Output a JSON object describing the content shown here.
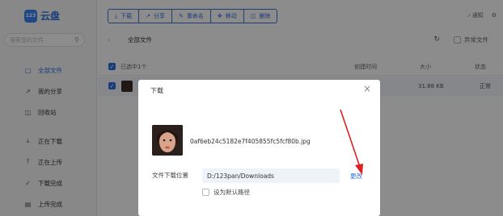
{
  "app": {
    "logo_badge": "123",
    "logo_text": "云盘"
  },
  "sidebar": {
    "search_placeholder": "搜索您的文件",
    "items": [
      {
        "label": "全部文件",
        "icon": "folder-icon"
      },
      {
        "label": "我的分享",
        "icon": "share-icon"
      },
      {
        "label": "回收站",
        "icon": "trash-icon"
      },
      {
        "label": "正在下载",
        "icon": "download-icon"
      },
      {
        "label": "正在上传",
        "icon": "upload-icon"
      },
      {
        "label": "下载完成",
        "icon": "check-circle-icon"
      },
      {
        "label": "上传完成",
        "icon": "file-icon"
      }
    ]
  },
  "toolbar": {
    "download": "下载",
    "share": "分享",
    "rename": "重命名",
    "move": "移动",
    "delete": "删除"
  },
  "topright": {
    "notify": "通知"
  },
  "crumb": {
    "current": "全部文件",
    "exception": "异常文件"
  },
  "table": {
    "selected_label": "已选中1个",
    "col_time": "创建时间",
    "col_size": "大小",
    "col_status": "状态",
    "row": {
      "size": "31.88 KB",
      "status": "正常"
    }
  },
  "dialog": {
    "title": "下载",
    "file_name": "0af6eb24c5182e7f405855fc5fcf80b.jpg",
    "location_label": "文件下载位置",
    "location_value": "D:/123pan/Downloads",
    "change_label": "更改",
    "default_label": "设为默认路径"
  },
  "colors": {
    "accent": "#2f6fe0",
    "annotation_arrow": "#e02020"
  }
}
